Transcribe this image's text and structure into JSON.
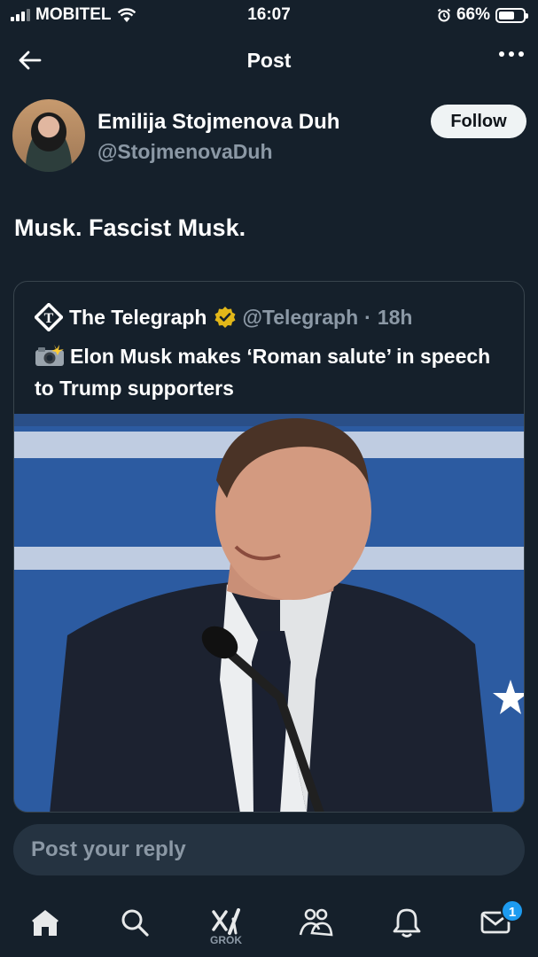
{
  "status_bar": {
    "carrier": "MOBITEL",
    "time": "16:07",
    "battery_text": "66%",
    "battery_level": 0.66
  },
  "header": {
    "title": "Post",
    "back_icon": "arrow-left-icon",
    "more_icon": "more-dots-icon"
  },
  "author": {
    "name": "Emilija Stojmenova Duh",
    "handle": "@StojmenovaDuh",
    "follow_label": "Follow"
  },
  "post": {
    "text": "Musk. Fascist Musk."
  },
  "quote": {
    "name": "The Telegraph",
    "handle": "@Telegraph",
    "separator": "·",
    "time": "18h",
    "text": "Elon Musk makes ‘Roman salute’ in speech to Trump supporters",
    "emoji_icon": "camera-flash-icon"
  },
  "reply": {
    "placeholder": "Post your reply"
  },
  "tabbar": {
    "grok_label": "GROK",
    "messages_badge": "1",
    "items": [
      "home-icon",
      "search-icon",
      "grok-icon",
      "communities-icon",
      "notifications-icon",
      "messages-icon"
    ]
  },
  "colors": {
    "background": "#15202b",
    "secondary_text": "#8b98a5",
    "accent": "#1d9bf0",
    "verified_gold": "#e2b719"
  }
}
